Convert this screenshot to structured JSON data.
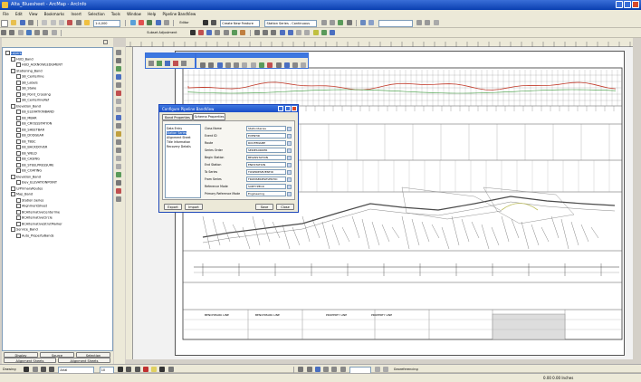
{
  "window": {
    "title": "Alta_Bluesheet - ArcMap - ArcInfo"
  },
  "menu": [
    "File",
    "Edit",
    "View",
    "Bookmarks",
    "Insert",
    "Selection",
    "Tools",
    "Window",
    "Help",
    "Pipeline BandView"
  ],
  "toolbar1": {
    "scale": "1:4,000",
    "task": "Create New Feature",
    "target": "Station Series - Continuous",
    "editor": "Editor"
  },
  "toolbar2": {
    "subset_adjust": "Subset Adjustment"
  },
  "toc": {
    "items": [
      {
        "label": "Layers",
        "indent": 0
      },
      {
        "label": "HUD_Band",
        "indent": 1
      },
      {
        "label": "HUD_ACKNOWLEDGMENT",
        "indent": 2
      },
      {
        "label": "Stationing_Band",
        "indent": 1
      },
      {
        "label": "SB_Centerline",
        "indent": 2
      },
      {
        "label": "SB_Labels",
        "indent": 2
      },
      {
        "label": "SB_Stake",
        "indent": 2
      },
      {
        "label": "SB_Point_Crossing",
        "indent": 2
      },
      {
        "label": "SB_CenterlineRef",
        "indent": 2
      },
      {
        "label": "Elevation_Band",
        "indent": 1
      },
      {
        "label": "EB_ELEVATIONBAND",
        "indent": 2
      },
      {
        "label": "EB_MBAR",
        "indent": 2
      },
      {
        "label": "EB_CROSSSTATION",
        "indent": 2
      },
      {
        "label": "EB_SHEETBAR",
        "indent": 2
      },
      {
        "label": "EB_DODGEAR",
        "indent": 2
      },
      {
        "label": "EB_TBSC",
        "indent": 2
      },
      {
        "label": "EB_BACKDOVER",
        "indent": 2
      },
      {
        "label": "EB_WELD",
        "indent": 2
      },
      {
        "label": "EB_CASING",
        "indent": 2
      },
      {
        "label": "EB_STEELPRESSURE",
        "indent": 2
      },
      {
        "label": "EB_COATING",
        "indent": 2
      },
      {
        "label": "Elevation_Band",
        "indent": 1
      },
      {
        "label": "Elev_ELEVATIONPOINT",
        "indent": 2
      },
      {
        "label": "U/PrimaryRoutes",
        "indent": 1
      },
      {
        "label": "Map_Band",
        "indent": 1
      },
      {
        "label": "Station Series",
        "indent": 2
      },
      {
        "label": "AlignmentSheet",
        "indent": 2
      },
      {
        "label": "BCAlternativeCenterline",
        "indent": 2
      },
      {
        "label": "BCAlternativeCircle",
        "indent": 2
      },
      {
        "label": "BCAlternativeStrutMarker",
        "indent": 2
      },
      {
        "label": "Service_Band",
        "indent": 1
      },
      {
        "label": "Auto_PropertyBands",
        "indent": 2
      }
    ],
    "tabs": [
      "Display",
      "Source",
      "Selection"
    ],
    "bottom_tabs": [
      "Alignment Sheets",
      "Alignment Sheets"
    ]
  },
  "dialog": {
    "title": "Configure Pipeline BandView",
    "tabs": [
      "Band Properties",
      "Schema Properties"
    ],
    "list": [
      "Data Entry",
      "Station Series",
      "Alignment Sheet",
      "Title Information",
      "Recovery Details"
    ],
    "fields": [
      {
        "label": "Class Name",
        "value": "StationSeries"
      },
      {
        "label": "Event ID",
        "value": "EVENTID"
      },
      {
        "label": "Route",
        "value": "ROUTENAME"
      },
      {
        "label": "Series Order",
        "value": "SERIESORDER"
      },
      {
        "label": "Begin Station",
        "value": "BEGINSTATION"
      },
      {
        "label": "End Station",
        "value": "ENDSTATION"
      },
      {
        "label": "To Series",
        "value": "TOSERIESEVENTID"
      },
      {
        "label": "From Series",
        "value": "FROMSERIESEVENTID"
      },
      {
        "label": "Reference Mode",
        "value": "SUBTYPECD"
      },
      {
        "label": "Primary Reference Mode",
        "value": "Engineering"
      }
    ],
    "buttons": {
      "export": "Export",
      "import": "Import",
      "save": "Save",
      "close": "Close"
    }
  },
  "mini_windows": [
    {
      "title": "Pipeline Tools"
    },
    {
      "title": "Pipeline BandView Tools"
    }
  ],
  "sheet": {
    "bottom_labels": [
      "BENCHMARK LINE",
      "BENCHMARK LINE",
      "PROPERTY LINE",
      "PROPERTY LINE"
    ]
  },
  "statusbar": {
    "drawing": "Drawing",
    "font": "Arial",
    "size": "10",
    "georef": "Georeferencing",
    "coords": "0.00  0.00 Inches"
  },
  "colors": {
    "title_blue": "#0a3fb0",
    "toolbar_bg": "#ece9d8",
    "map_line": "#4a4a4a",
    "route_red": "#c23a2a",
    "route_green": "#3a9a3a"
  }
}
